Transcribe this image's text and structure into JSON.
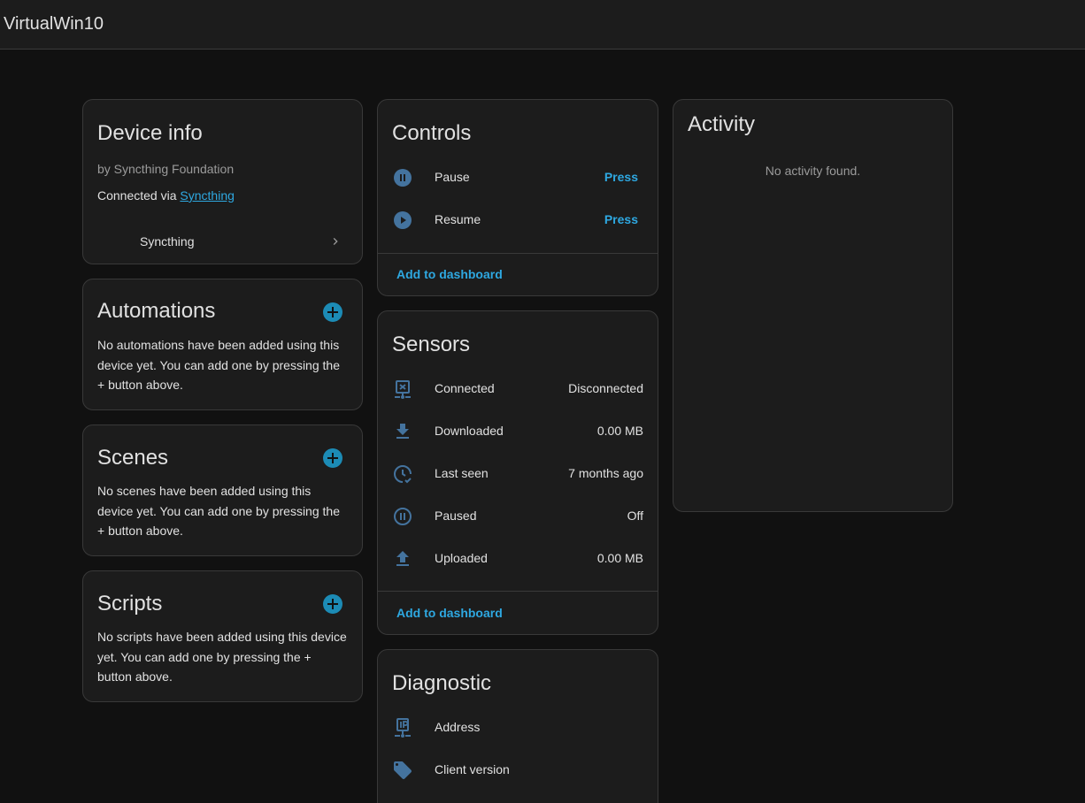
{
  "header": {
    "title": "VirtualWin10"
  },
  "device_info": {
    "title": "Device info",
    "manufacturer": "by Syncthing Foundation",
    "connected_prefix": "Connected via ",
    "connected_link": "Syncthing",
    "integration_item": "Syncthing"
  },
  "automations": {
    "title": "Automations",
    "empty_text": "No automations have been added using this device yet. You can add one by pressing the + button above."
  },
  "scenes": {
    "title": "Scenes",
    "empty_text": "No scenes have been added using this device yet. You can add one by pressing the + button above."
  },
  "scripts": {
    "title": "Scripts",
    "empty_text": "No scripts have been added using this device yet. You can add one by pressing the + button above."
  },
  "controls": {
    "title": "Controls",
    "items": [
      {
        "icon": "pause-circle-icon",
        "label": "Pause",
        "action": "Press"
      },
      {
        "icon": "play-circle-icon",
        "label": "Resume",
        "action": "Press"
      }
    ],
    "add_to_dashboard": "Add to dashboard"
  },
  "sensors": {
    "title": "Sensors",
    "items": [
      {
        "icon": "network-off-icon",
        "label": "Connected",
        "value": "Disconnected"
      },
      {
        "icon": "download-icon",
        "label": "Downloaded",
        "value": "0.00 MB"
      },
      {
        "icon": "clock-check-icon",
        "label": "Last seen",
        "value": "7 months ago"
      },
      {
        "icon": "pause-circle-outline-icon",
        "label": "Paused",
        "value": "Off"
      },
      {
        "icon": "upload-icon",
        "label": "Uploaded",
        "value": "0.00 MB"
      }
    ],
    "add_to_dashboard": "Add to dashboard"
  },
  "diagnostic": {
    "title": "Diagnostic",
    "items": [
      {
        "icon": "ip-network-icon",
        "label": "Address"
      },
      {
        "icon": "tag-icon",
        "label": "Client version"
      }
    ]
  },
  "activity": {
    "title": "Activity",
    "empty_text": "No activity found."
  },
  "colors": {
    "background": "#111111",
    "card": "#1c1c1c",
    "accent": "#2ea8e1",
    "icon": "#44739e",
    "plus": "#1c8bb5"
  }
}
